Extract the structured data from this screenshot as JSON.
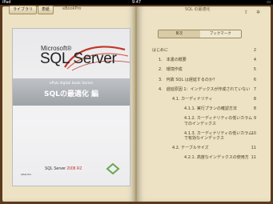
{
  "status": {
    "device": "iPad",
    "time": "9:47"
  },
  "header": {
    "library_button": "ライブラリ",
    "cover_button": "表紙",
    "book_title": "eBookPro",
    "chapter_title": "SQL の最適化"
  },
  "cover": {
    "brand": "Microsoft®",
    "product": "SQL Server",
    "series": "ePub digital book Series",
    "subtitle": "SQLの最適化 編",
    "mini_logo": "SQL Server",
    "mini_version": "2008 R2",
    "publisher_small": "ePub Pro"
  },
  "tabs": [
    {
      "label": "目次",
      "active": true
    },
    {
      "label": "ブックマーク",
      "active": false
    }
  ],
  "toc": [
    {
      "level": 0,
      "label": "はじめに",
      "page": "2"
    },
    {
      "level": 1,
      "label": "1.　本書の概要",
      "page": "4"
    },
    {
      "level": 1,
      "label": "2.　環境作成",
      "page": "5"
    },
    {
      "level": 1,
      "label": "3.　何故 SQL は遅延するのか？",
      "page": "6"
    },
    {
      "level": 1,
      "label": "4.　遅延原因 1：インデックスが作成されていない",
      "page": "7"
    },
    {
      "level": 2,
      "label": "4.1. カーディナリティ",
      "page": "8"
    },
    {
      "level": 3,
      "label": "4.1.1. 実行プランの確認方法",
      "page": "8"
    },
    {
      "level": 3,
      "label": "4.1.2. カーディナリティの低いカラムでのインデックス",
      "page": "9"
    },
    {
      "level": 3,
      "label": "4.1.3. カーディナリティの低いカラムで有効なインデックス",
      "page": "10"
    },
    {
      "level": 2,
      "label": "4.2. テーブルサイズ",
      "page": "11"
    },
    {
      "level": 3,
      "label": "4.2.1. 高度なインデックスの使用方",
      "page": "11"
    }
  ]
}
